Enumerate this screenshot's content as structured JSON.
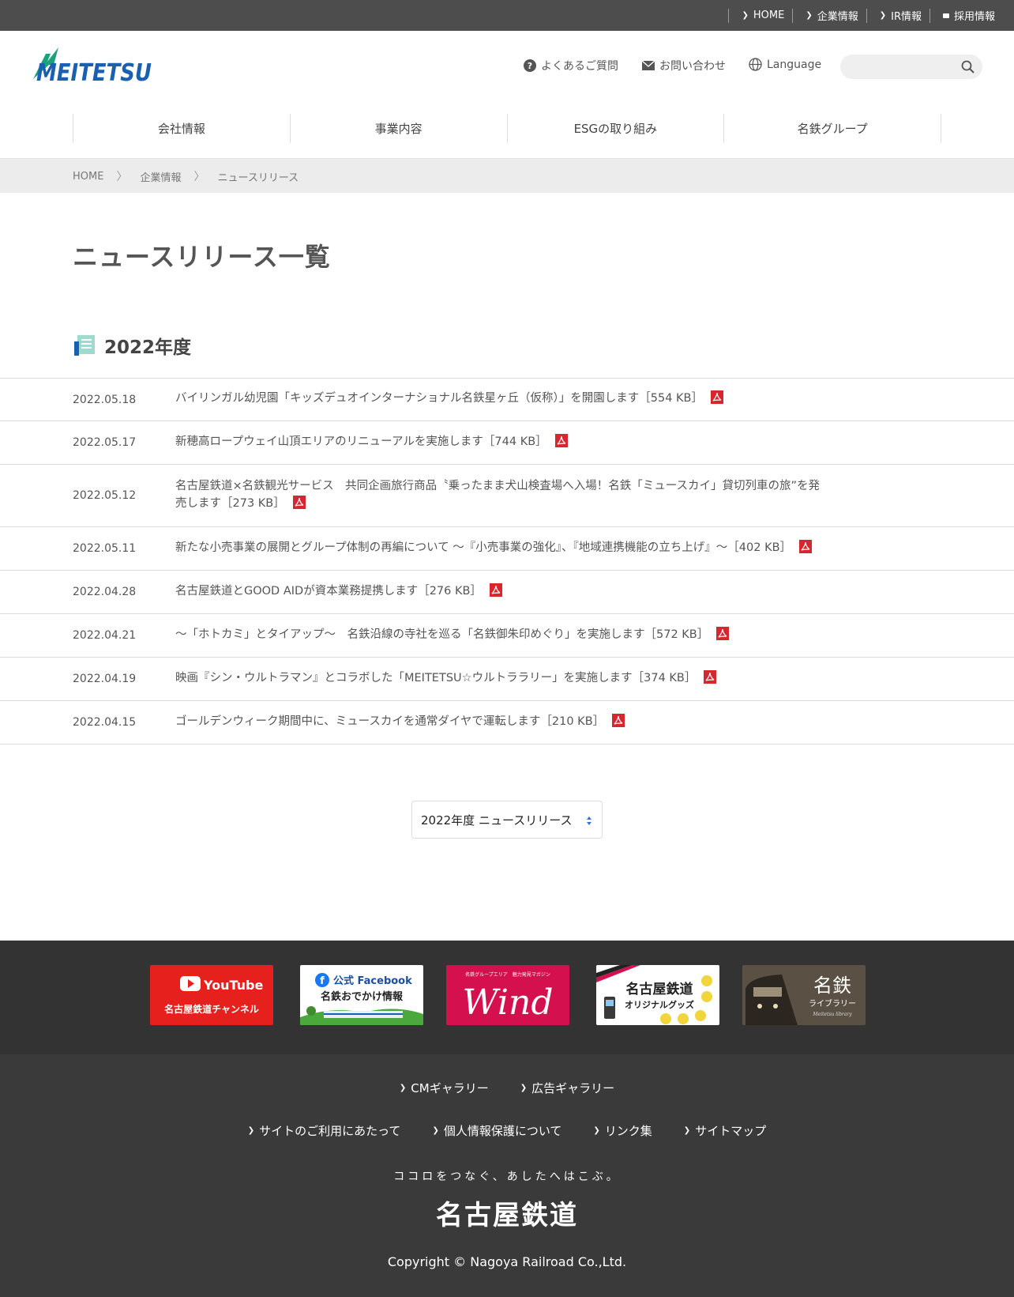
{
  "topbar": {
    "links": [
      "HOME",
      "企業情報",
      "IR情報",
      "採用情報"
    ]
  },
  "header": {
    "logo_text": "MEITETSU",
    "faq": "よくあるご質問",
    "contact": "お問い合わせ",
    "language": "Language",
    "search_placeholder": ""
  },
  "gnav": [
    "会社情報",
    "事業内容",
    "ESGの取り組み",
    "名鉄グループ"
  ],
  "breadcrumb": [
    "HOME",
    "企業情報",
    "ニュースリリース"
  ],
  "page_title": "ニュースリリース一覧",
  "section_title": "2022年度",
  "news": [
    {
      "date": "2022.05.18",
      "title": "バイリンガル幼児園「キッズデュオインターナショナル名鉄星ヶ丘（仮称）」を開園します［554 KB］"
    },
    {
      "date": "2022.05.17",
      "title": "新穂高ロープウェイ山頂エリアのリニューアルを実施します［744 KB］"
    },
    {
      "date": "2022.05.12",
      "title": "名古屋鉄道×名鉄観光サービス　共同企画旅行商品〝乗ったまま犬山検査場へ入場！名鉄「ミュースカイ」貸切列車の旅”を発売します［273 KB］"
    },
    {
      "date": "2022.05.11",
      "title": "新たな小売事業の展開とグループ体制の再編について 〜『小売事業の強化』、『地域連携機能の立ち上げ』〜［402 KB］"
    },
    {
      "date": "2022.04.28",
      "title": "名古屋鉄道とGOOD AIDが資本業務提携します［276 KB］"
    },
    {
      "date": "2022.04.21",
      "title": "〜「ホトカミ」とタイアップ〜　名鉄沿線の寺社を巡る「名鉄御朱印めぐり」を実施します［572 KB］"
    },
    {
      "date": "2022.04.19",
      "title": "映画『シン・ウルトラマン』とコラボした「MEITETSU☆ウルトララリー」を実施します［374 KB］"
    },
    {
      "date": "2022.04.15",
      "title": "ゴールデンウィーク期間中に、ミュースカイを通常ダイヤで運転します［210 KB］"
    }
  ],
  "year_select": {
    "selected": "2022年度 ニュースリリース"
  },
  "banners": {
    "youtube": {
      "brand": "YouTube",
      "label": "名古屋鉄道チャンネル"
    },
    "facebook": {
      "brand": "公式 Facebook",
      "label": "名鉄おでかけ情報"
    },
    "wind": {
      "sub": "名鉄グループエリア　魅力発見マガジン",
      "label": "Wind"
    },
    "goods": {
      "label1": "名古屋鉄道",
      "label2": "オリジナルグッズ"
    },
    "library": {
      "label1": "名鉄",
      "label2": "ライブラリー",
      "label3": "Meitetsu library"
    }
  },
  "footer": {
    "row1": [
      "CMギャラリー",
      "広告ギャラリー"
    ],
    "row2": [
      "サイトのご利用にあたって",
      "個人情報保護について",
      "リンク集",
      "サイトマップ"
    ],
    "tagline": "ココロをつなぐ、あしたへはこぶ。",
    "corp": "名古屋鉄道",
    "copyright": "Copyright © Nagoya Railroad Co.,Ltd."
  },
  "colors": {
    "topbar": "#4d4d4d",
    "logo_blue": "#1a5fb0",
    "logo_green": "#1aa37a",
    "pdf_red": "#d7262e",
    "footer_dark": "#333333",
    "youtube_red": "#e5201d",
    "wind_pink": "#d5104f"
  }
}
